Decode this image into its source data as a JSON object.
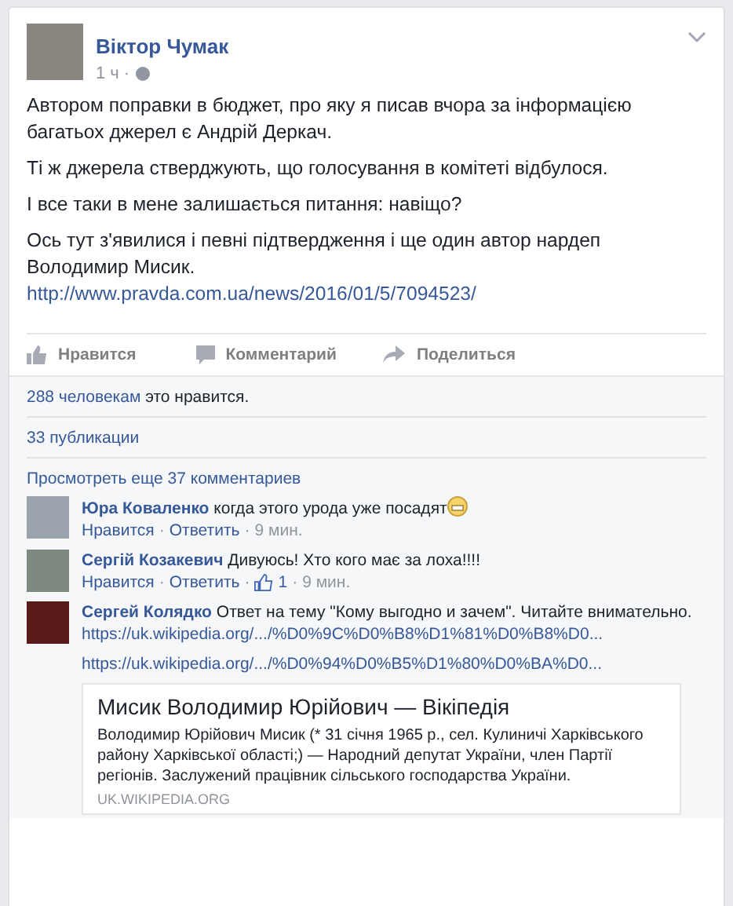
{
  "post": {
    "author": "Віктор Чумак",
    "time": "1 ч",
    "paragraphs": [
      "Автором поправки в бюджет, про яку я писав вчора за інформацією багатьох джерел є Андрій Деркач.",
      "Ті ж джерела стверджують, що голосування в комітеті відбулося.",
      "І все таки в мене залишається питання: навіщо?",
      "Ось тут з'явилися і певні підтвердження і ще один автор нардеп Володимир Мисик."
    ],
    "link": "http://www.pravda.com.ua/news/2016/01/5/7094523/"
  },
  "actions": [
    {
      "kind": "like",
      "label": "Нравится"
    },
    {
      "kind": "comment",
      "label": "Комментарий"
    },
    {
      "kind": "share",
      "label": "Поделиться"
    }
  ],
  "separator": "·",
  "likes": {
    "count": "288 человекам",
    "rest": "это нравится."
  },
  "shares": "33 публикации",
  "more_comments": "Просмотреть еще 37 комментариев",
  "comments": [
    {
      "author": "Юра Коваленко",
      "text": "когда этого урода уже посадят",
      "emoji": true,
      "like": "Нравится",
      "reply": "Ответить",
      "time": "9 мин."
    },
    {
      "author": "Сергій Козакевич",
      "text": "Дивуюсь! Хто кого має за лоха!!!!",
      "emoji": false,
      "like": "Нравится",
      "reply": "Ответить",
      "likes": "1",
      "time": "9 мин."
    },
    {
      "author": "Сергей Колядко",
      "text": "Ответ на тему \"Кому выгодно и зачем\". Читайте внимательно.",
      "emoji": false,
      "inline_link": "https://uk.wikipedia.org/.../%D0%9C%D0%B8%D1%81%D0%B8%D0...",
      "link": "https://uk.wikipedia.org/.../%D0%94%D0%B5%D1%80%D0%BA%D0...",
      "preview": {
        "title": "Мисик Володимир Юрійович — Вікіпедія",
        "description": "Володимир Юрійович Мисик (* 31 січня 1965 р., сел. Кулиничі Харківського району Харківської області;) — Народний депутат України, член Партії регіонів. Заслужений працівник сільського господарства України.",
        "domain": "UK.WIKIPEDIA.ORG"
      }
    }
  ]
}
